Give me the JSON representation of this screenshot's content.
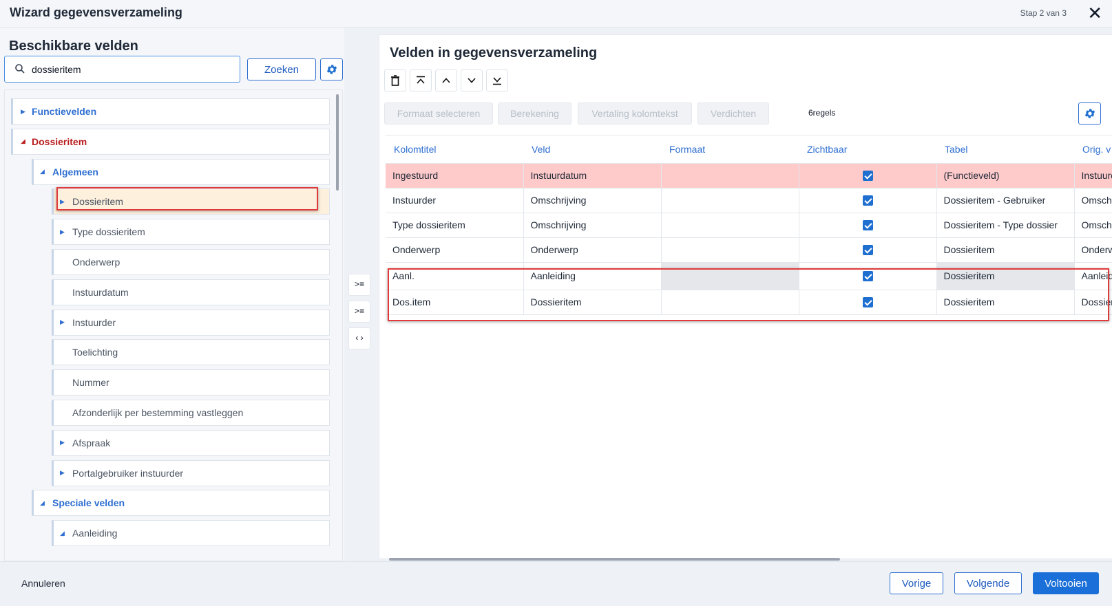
{
  "window": {
    "title": "Wizard gegevensverzameling",
    "step": "Stap 2 van 3"
  },
  "left": {
    "heading": "Beschikbare velden",
    "search": {
      "value": "dossieritem",
      "button": "Zoeken"
    },
    "tree": [
      {
        "label": "Functievelden",
        "level": 0,
        "kind": "group",
        "expanded": false
      },
      {
        "label": "Dossieritem",
        "level": 0,
        "kind": "red",
        "expanded": true
      },
      {
        "label": "Algemeen",
        "level": 1,
        "kind": "group",
        "expanded": true
      },
      {
        "label": "Dossieritem",
        "level": 2,
        "kind": "child",
        "expanded": false,
        "selected": true
      },
      {
        "label": "Type dossieritem",
        "level": 2,
        "kind": "child",
        "expanded": false
      },
      {
        "label": "Onderwerp",
        "level": 2,
        "kind": "leaf"
      },
      {
        "label": "Instuurdatum",
        "level": 2,
        "kind": "leaf"
      },
      {
        "label": "Instuurder",
        "level": 2,
        "kind": "child",
        "expanded": false
      },
      {
        "label": "Toelichting",
        "level": 2,
        "kind": "leaf"
      },
      {
        "label": "Nummer",
        "level": 2,
        "kind": "leaf"
      },
      {
        "label": "Afzonderlijk per bestemming vastleggen",
        "level": 2,
        "kind": "leaf"
      },
      {
        "label": "Afspraak",
        "level": 2,
        "kind": "child",
        "expanded": false
      },
      {
        "label": "Portalgebruiker instuurder",
        "level": 2,
        "kind": "child",
        "expanded": false
      },
      {
        "label": "Speciale velden",
        "level": 1,
        "kind": "group",
        "expanded": true
      },
      {
        "label": "Aanleiding",
        "level": 2,
        "kind": "child",
        "expanded": true
      }
    ]
  },
  "right": {
    "heading": "Velden in gegevensverzameling",
    "actions": [
      "Formaat selecteren",
      "Berekening",
      "Vertaling kolomtekst",
      "Verdichten"
    ],
    "rowcount": "6regels",
    "columns": [
      "Kolomtitel",
      "Veld",
      "Formaat",
      "Zichtbaar",
      "Tabel",
      "Orig. v"
    ],
    "rows": [
      {
        "kolomtitel": "Ingestuurd",
        "veld": "Instuurdatum",
        "formaat": "",
        "zichtbaar": true,
        "tabel": "(Functieveld)",
        "orig": "Instuurdatum"
      },
      {
        "kolomtitel": "Instuurder",
        "veld": "Omschrijving",
        "formaat": "",
        "zichtbaar": true,
        "tabel": "Dossieritem - Gebruiker",
        "orig": "Omschrijving"
      },
      {
        "kolomtitel": "Type dossieritem",
        "veld": "Omschrijving",
        "formaat": "",
        "zichtbaar": true,
        "tabel": "Dossieritem - Type dossier",
        "orig": "Omschrijving"
      },
      {
        "kolomtitel": "Onderwerp",
        "veld": "Onderwerp",
        "formaat": "",
        "zichtbaar": true,
        "tabel": "Dossieritem",
        "orig": "Onderwerp"
      },
      {
        "kolomtitel": "Aanl.",
        "veld": "Aanleiding",
        "formaat": "",
        "zichtbaar": true,
        "tabel": "Dossieritem",
        "orig": "Aanleiding"
      },
      {
        "kolomtitel": "Dos.item",
        "veld": "Dossieritem",
        "formaat": "",
        "zichtbaar": true,
        "tabel": "Dossieritem",
        "orig": "Dossieritem"
      }
    ]
  },
  "footer": {
    "cancel": "Annuleren",
    "prev": "Vorige",
    "next": "Volgende",
    "finish": "Voltooien"
  },
  "colors": {
    "accent": "#2f6fd1",
    "highlight_row": "#fecaca",
    "annotation": "#e03a3a"
  }
}
